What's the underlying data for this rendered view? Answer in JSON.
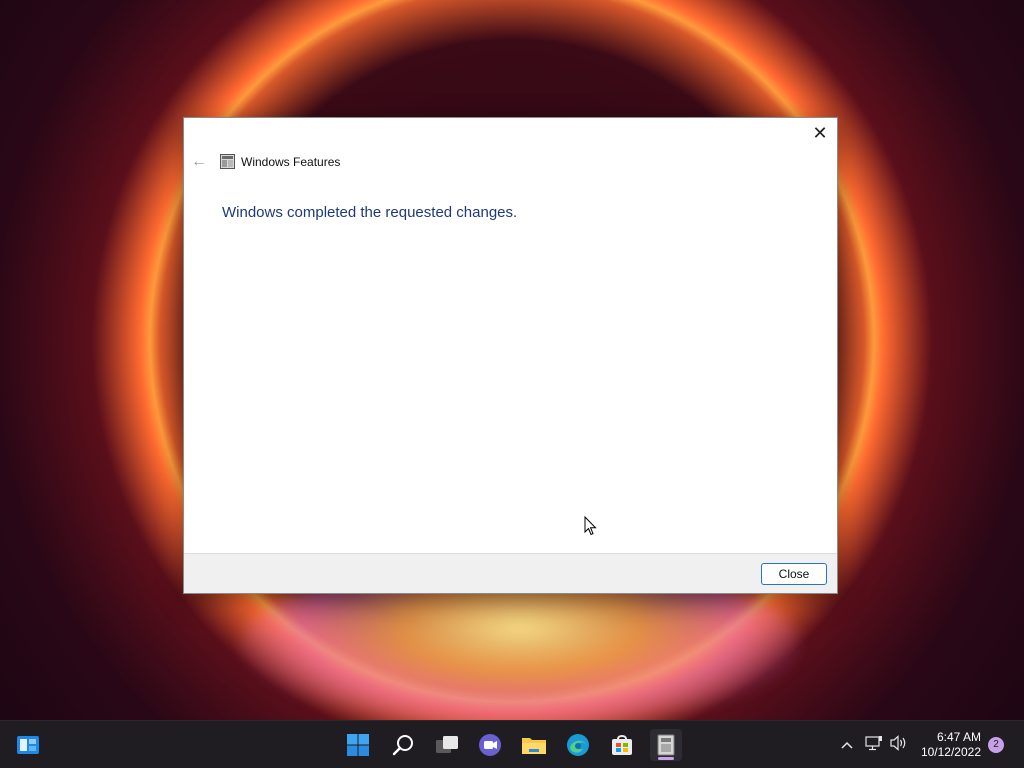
{
  "dialog": {
    "title": "Windows Features",
    "message": "Windows completed the requested changes.",
    "close_label": "Close",
    "close_glyph": "✕",
    "back_glyph": "←"
  },
  "taskbar": {
    "items": [
      {
        "name": "widgets-icon"
      },
      {
        "name": "start-icon"
      },
      {
        "name": "search-icon"
      },
      {
        "name": "task-view-icon"
      },
      {
        "name": "chat-icon"
      },
      {
        "name": "file-explorer-icon"
      },
      {
        "name": "edge-icon"
      },
      {
        "name": "store-icon"
      },
      {
        "name": "windows-features-icon",
        "active": true
      }
    ],
    "tray": {
      "chevron": "^",
      "time": "6:47 AM",
      "date": "10/12/2022",
      "notification_count": "2"
    }
  },
  "colors": {
    "message": "#1e3a78",
    "button_border": "#2b73c4",
    "taskbar": "#1f1d22",
    "badge": "#c8a0e8"
  }
}
